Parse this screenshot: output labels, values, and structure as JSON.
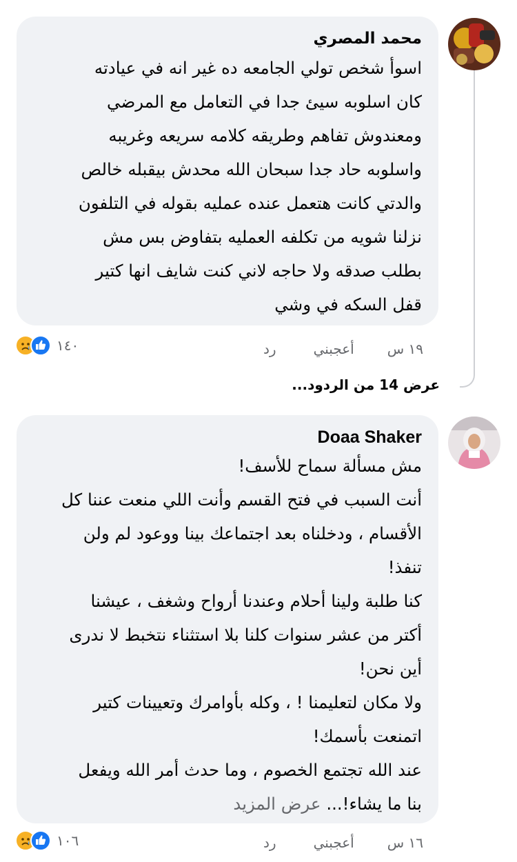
{
  "comments": [
    {
      "author": "محمد المصري",
      "lines": [
        "اسوأ شخص تولي الجامعه ده غير انه في عيادته",
        "كان اسلوبه سيئ جدا في التعامل مع المرضي",
        "ومعندوش تفاهم وطريقه كلامه سريعه وغريبه",
        "واسلوبه حاد جدا سبحان الله محدش بيقبله خالص",
        "والدتي كانت هتعمل عنده عمليه بقوله في التلفون",
        "نزلنا شويه من تكلفه العمليه  بتفاوض بس مش",
        "بطلب صدقه ولا حاجه لاني كنت شايف انها كتير",
        "قفل السكه في وشي"
      ],
      "time": "١٩ س",
      "like_label": "أعجبني",
      "reply_label": "رد",
      "reaction_count": "١٤٠",
      "view_replies": "عرض 14 من الردود..."
    },
    {
      "author": "Doaa Shaker",
      "lines": [
        "مش مسألة سماح للأسف!",
        "أنت السبب في فتح القسم وأنت اللي منعت عننا كل",
        "الأقسام ، ودخلناه بعد اجتماعك بينا ووعود لم ولن",
        "تنفذ!",
        "كنا طلبة ولينا أحلام وعندنا أرواح وشغف ، عيشنا",
        "أكتر من عشر سنوات كلنا بلا استثناء نتخبط لا ندرى",
        "أين نحن!",
        "ولا مكان لتعليمنا ! ، وكله بأوامرك وتعيينات كتير",
        "اتمنعت بأسمك!",
        "عند الله تجتمع الخصوم ، وما حدث أمر الله ويفعل"
      ],
      "last_line": "بنا ما يشاء!...",
      "see_more": "عرض المزيد",
      "time": "١٦ س",
      "like_label": "أعجبني",
      "reply_label": "رد",
      "reaction_count": "١٠٦"
    }
  ],
  "colors": {
    "bubble": "#f0f2f5",
    "secondary_text": "#65676b",
    "like_blue": "#1877f2",
    "sad_yellow": "#f7b125",
    "thread_line": "#ced0d4"
  },
  "icons": [
    "like-reaction-icon",
    "sad-reaction-icon"
  ]
}
